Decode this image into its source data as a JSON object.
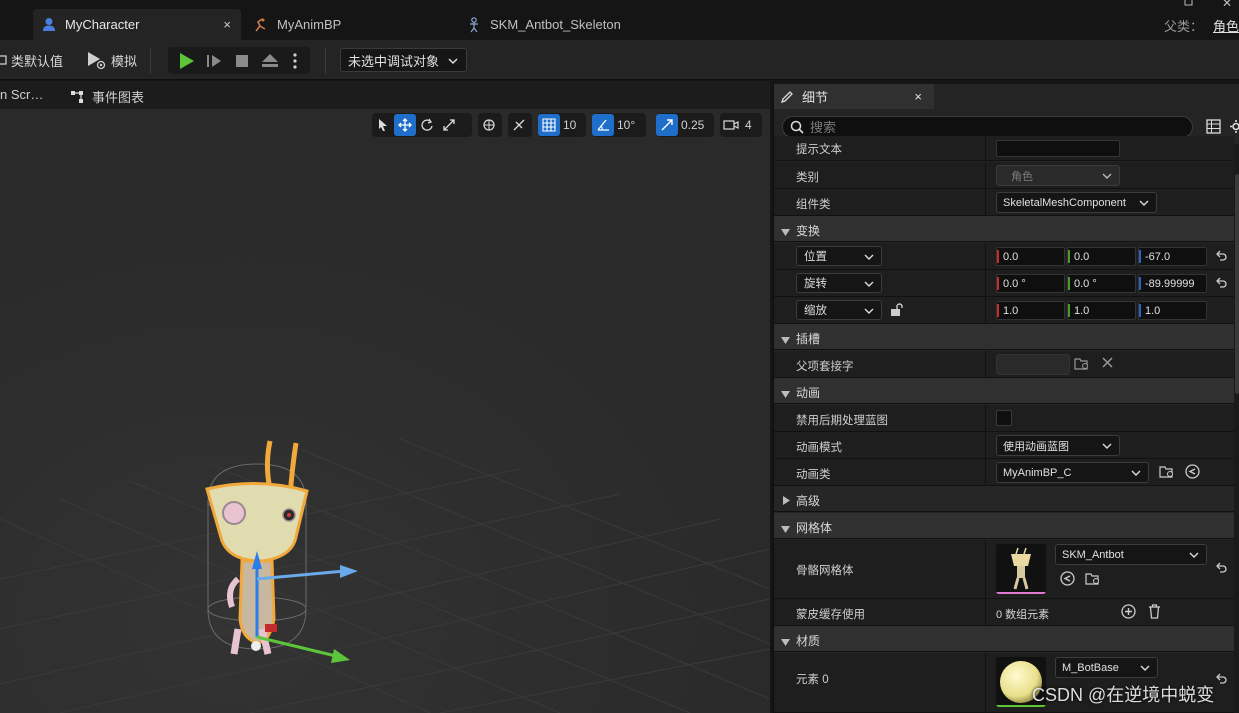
{
  "tabs": [
    {
      "label": "MyCharacter",
      "close": "×"
    },
    {
      "label": "MyAnimBP"
    },
    {
      "label": "SKM_Antbot_Skeleton"
    }
  ],
  "parent_class": {
    "label": "父类：",
    "value": "角色"
  },
  "toolbar": {
    "class_defaults": "类默认值",
    "simulate": "模拟",
    "debug_object": "未选中调试对象"
  },
  "viewport_tabs": [
    "n Scr…",
    "事件图表"
  ],
  "viewport_controls": {
    "grid": "10",
    "rotation": "10°",
    "scale": "0.25",
    "camera_speed": "4"
  },
  "details": {
    "tab_label": "细节",
    "tab_close": "×",
    "search_placeholder": "搜索",
    "rows": {
      "tooltip_text": "提示文本",
      "category": {
        "label": "类别",
        "value": "角色"
      },
      "component_class": {
        "label": "组件类",
        "value": "SkeletalMeshComponent"
      }
    },
    "transform": {
      "header": "变换",
      "location": {
        "label": "位置",
        "x": "0.0",
        "y": "0.0",
        "z": "-67.0"
      },
      "rotation": {
        "label": "旋转",
        "x": "0.0 °",
        "y": "0.0 °",
        "z": "-89.99999"
      },
      "scale": {
        "label": "缩放",
        "x": "1.0",
        "y": "1.0",
        "z": "1.0"
      }
    },
    "sockets": {
      "header": "插槽",
      "parent_socket": "父项套接字"
    },
    "animation": {
      "header": "动画",
      "disable_post_process": "禁用后期处理蓝图",
      "anim_mode": {
        "label": "动画模式",
        "value": "使用动画蓝图"
      },
      "anim_class": {
        "label": "动画类",
        "value": "MyAnimBP_C"
      },
      "advanced": "高级"
    },
    "mesh": {
      "header": "网格体",
      "skeletal_mesh": {
        "label": "骨骼网格体",
        "value": "SKM_Antbot"
      },
      "skin_cache": {
        "label": "蒙皮缓存使用",
        "value": "0 数组元素"
      }
    },
    "materials": {
      "header": "材质",
      "element0": {
        "label": "元素 0",
        "value": "M_BotBase"
      }
    }
  },
  "watermark": "CSDN @在逆境中蜕变",
  "colors": {
    "accent": "#1f6ec9",
    "play": "#5cc53a",
    "selection": "#f2a93b"
  }
}
